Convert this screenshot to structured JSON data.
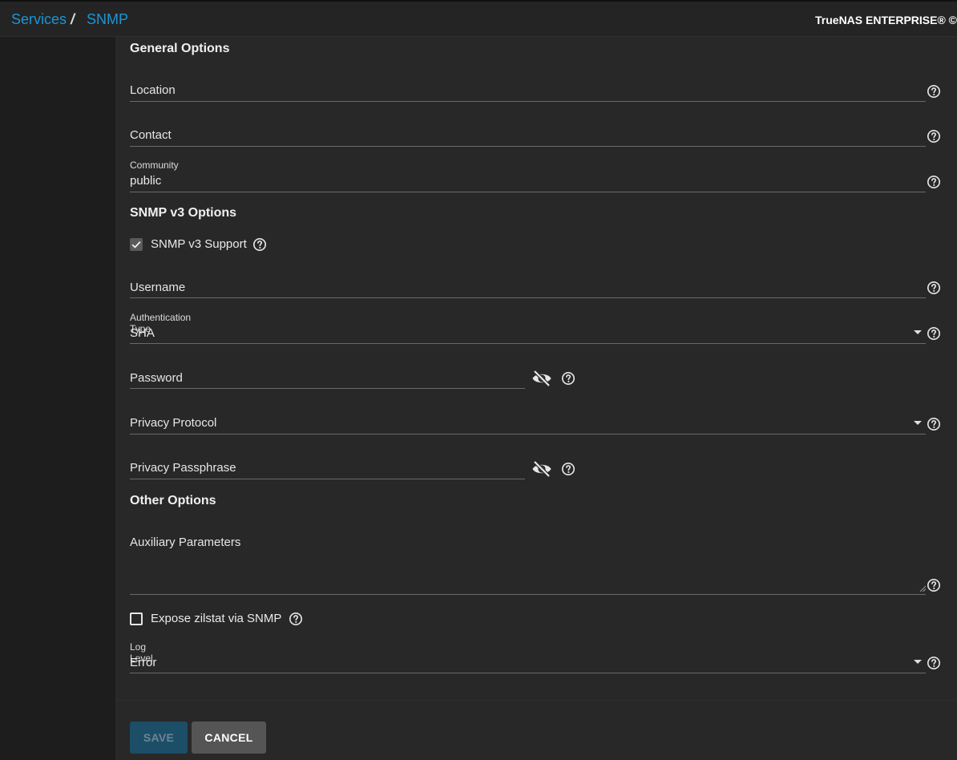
{
  "breadcrumb": {
    "services": "Services",
    "separator": "/",
    "current": "SNMP"
  },
  "brand": "TrueNAS ENTERPRISE® ©",
  "sections": {
    "general": "General Options",
    "snmpv3": "SNMP v3 Options",
    "other": "Other Options"
  },
  "fields": {
    "location": {
      "placeholder": "Location",
      "value": ""
    },
    "contact": {
      "placeholder": "Contact",
      "value": ""
    },
    "community": {
      "label": "Community",
      "value": "public"
    },
    "snmpv3_support": {
      "label": "SNMP v3 Support",
      "checked": true
    },
    "username": {
      "placeholder": "Username",
      "value": ""
    },
    "auth_type": {
      "label": "Authentication Type",
      "value": "SHA"
    },
    "password": {
      "placeholder": "Password",
      "value": ""
    },
    "privacy_protocol": {
      "placeholder": "Privacy Protocol",
      "value": ""
    },
    "privacy_passphrase": {
      "placeholder": "Privacy Passphrase",
      "value": ""
    },
    "aux_params": {
      "placeholder": "Auxiliary Parameters",
      "value": ""
    },
    "expose_zilstat": {
      "label": "Expose zilstat via SNMP",
      "checked": false
    },
    "log_level": {
      "label": "Log Level",
      "value": "Error"
    }
  },
  "buttons": {
    "save": "SAVE",
    "cancel": "CANCEL"
  },
  "icons": {
    "help": "help-circle-icon",
    "visibility": "eye-off-icon",
    "dropdown": "arrow-drop-down-icon",
    "check": "check-icon"
  },
  "colors": {
    "accent": "#1c95d4",
    "save_bg": "#1c4e68",
    "panel": "#282828"
  }
}
